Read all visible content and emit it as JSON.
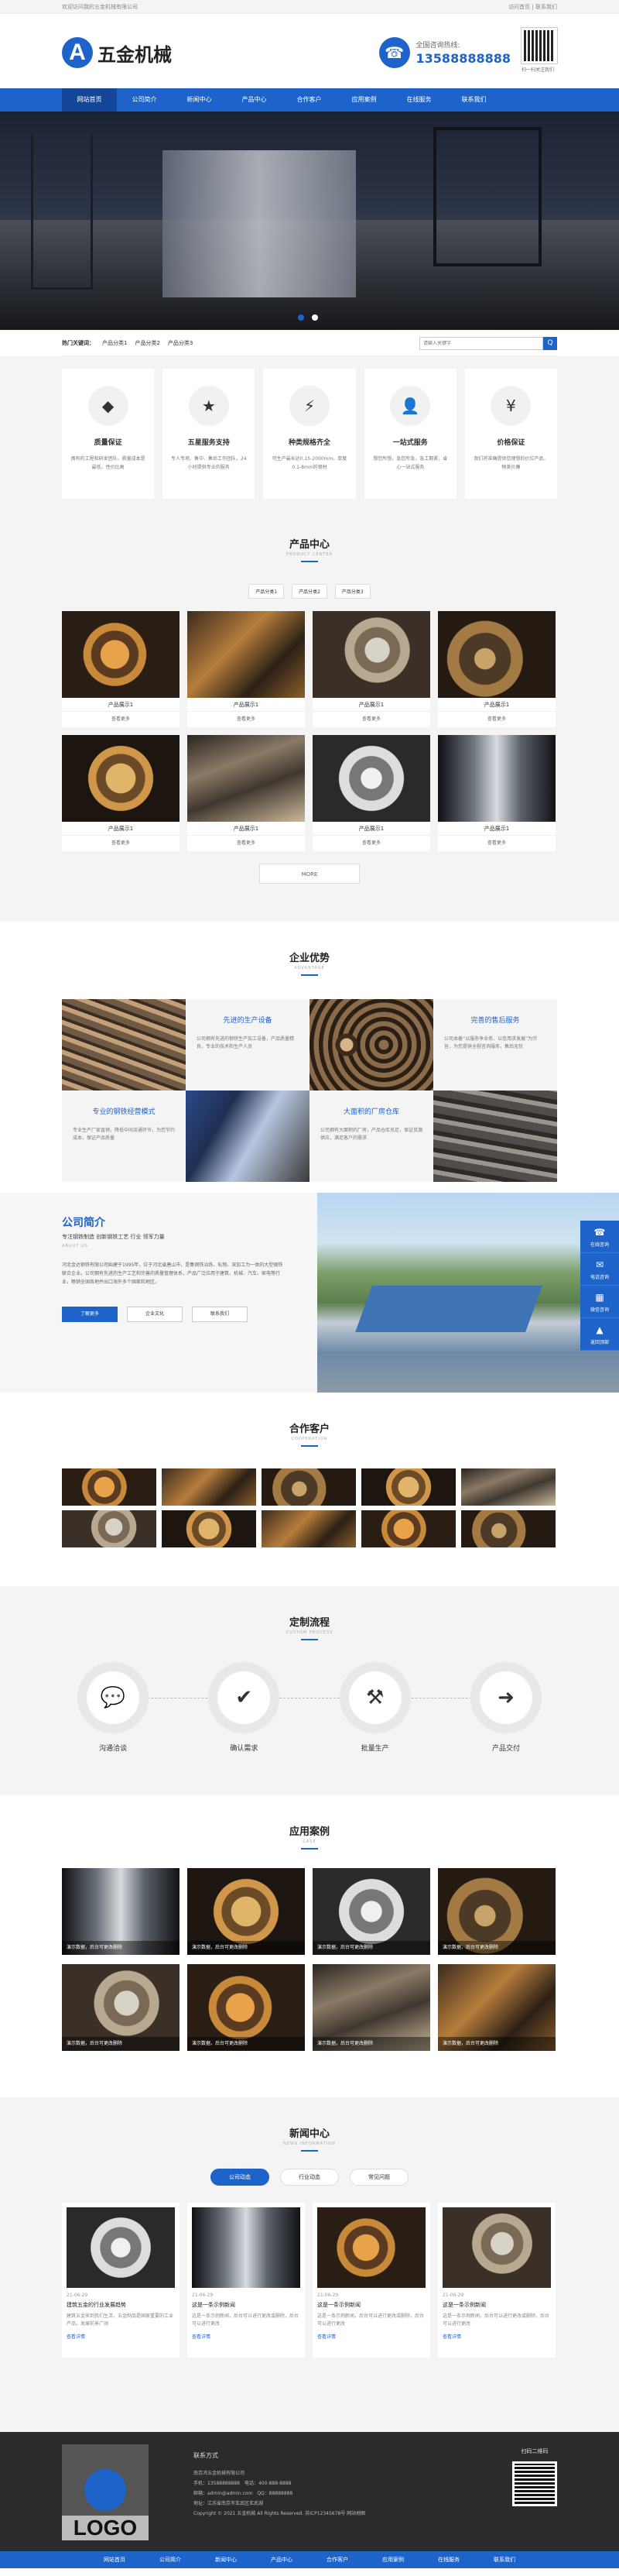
{
  "topbar": {
    "welcome": "欢迎访问我的五金机械有限公司",
    "links": "访问首页 | 联系我们"
  },
  "header": {
    "logo_letter": "A",
    "site_name": "五金机械",
    "hotline_label": "全国咨询热线:",
    "hotline": "13588888888",
    "qr_caption": "扫一扫关注我们"
  },
  "nav": [
    "网站首页",
    "公司简介",
    "新闻中心",
    "产品中心",
    "合作客户",
    "应用案例",
    "在线服务",
    "联系我们"
  ],
  "search": {
    "hot_label": "热门关键词：",
    "keywords": [
      "产品分类1",
      "产品分类2",
      "产品分类3"
    ],
    "placeholder": "请输入关键字",
    "button": "Q"
  },
  "features": [
    {
      "icon": "◆",
      "title": "质量保证",
      "desc": "拥有的工程和研发团队，质量成本是最低，性价比高"
    },
    {
      "icon": "★",
      "title": "五星服务支持",
      "desc": "专人专项、售中、售后工作团队，24小时提供专业的服务"
    },
    {
      "icon": "⚡",
      "title": "种类规格齐全",
      "desc": "可生产最长达0.15-2000mm，厚度0.1-8mm的钢材"
    },
    {
      "icon": "👤",
      "title": "一站式服务",
      "desc": "想您所想，急您所急，急工期紧，省心一站式服务"
    },
    {
      "icon": "¥",
      "title": "价格保证",
      "desc": "我们将准确提供您理想的价位产品，物美价廉"
    }
  ],
  "products": {
    "title": "产品中心",
    "en": "PRODUCT CENTER",
    "tabs": [
      "产品分类1",
      "产品分类2",
      "产品分类3"
    ],
    "items": [
      {
        "name": "产品展示1",
        "more": "查看更多"
      },
      {
        "name": "产品展示1",
        "more": "查看更多"
      },
      {
        "name": "产品展示1",
        "more": "查看更多"
      },
      {
        "name": "产品展示1",
        "more": "查看更多"
      },
      {
        "name": "产品展示1",
        "more": "查看更多"
      },
      {
        "name": "产品展示1",
        "more": "查看更多"
      },
      {
        "name": "产品展示1",
        "more": "查看更多"
      },
      {
        "name": "产品展示1",
        "more": "查看更多"
      }
    ],
    "more": "MORE"
  },
  "advantages": {
    "title": "企业优势",
    "en": "ADVANTAGE",
    "cells": [
      {
        "title": "先进的生产设备",
        "desc": "公司拥有先进的钢铁生产加工设备，产品质量精良，专业的技术和生产人员"
      },
      {
        "title": "完善的售后服务",
        "desc": "公司本着“以服务争业务，以信用求发展”为宗旨，为您提供全程咨询服务，售后无忧"
      },
      {
        "title": "专业的钢铁经营模式",
        "desc": "专业生产厂家直销，降低中间流通环节，为您节约成本，保证产品质量"
      },
      {
        "title": "大面积的厂房仓库",
        "desc": "公司拥有大面积的厂房，产品仓库充足，保证货源供应，满足客户的需求"
      }
    ]
  },
  "about": {
    "title": "公司简介",
    "subtitle": "专注钢铁制造 创新钢铁工艺 行业 领军力量",
    "en": "ABOUT US",
    "desc": "河北金达钢铁有限公司始建于1995年，位于河北省唐山市，是集钢铁冶炼、轧制、深加工为一体的大型钢铁联合企业。公司拥有先进的生产工艺和完善的质量管理体系，产品广泛应用于建筑、机械、汽车、家电等行业，畅销全国各地并出口海外多个国家和地区。",
    "buttons": [
      "了解更多",
      "企业文化",
      "联系我们"
    ]
  },
  "customers": {
    "title": "合作客户",
    "en": "COOPERATION"
  },
  "process": {
    "title": "定制流程",
    "en": "CUSTOM PROCESS",
    "steps": [
      {
        "icon": "💬",
        "label": "沟通洽谈"
      },
      {
        "icon": "✔",
        "label": "确认需求"
      },
      {
        "icon": "⚒",
        "label": "批量生产"
      },
      {
        "icon": "➜",
        "label": "产品交付"
      }
    ]
  },
  "cases": {
    "title": "应用案例",
    "en": "CASE",
    "items": [
      "演示数据，后台可更改删除",
      "演示数据，后台可更改删除",
      "演示数据，后台可更改删除",
      "演示数据，后台可更改删除",
      "演示数据，后台可更改删除",
      "演示数据，后台可更改删除",
      "演示数据，后台可更改删除",
      "演示数据，后台可更改删除"
    ]
  },
  "news": {
    "title": "新闻中心",
    "en": "NEWS INFORMATION",
    "tabs": [
      "公司动态",
      "行业动态",
      "常见问题"
    ],
    "items": [
      {
        "date": "21-06-29",
        "title": "建筑五金的行业发展趋势",
        "desc": "建筑五金来到我们生活，五金制品是国家重要的工业产品，发展前景广阔",
        "more": "查看详情"
      },
      {
        "date": "21-06-29",
        "title": "这是一条示例新闻",
        "desc": "这是一条示例新闻，后台可以进行更改或删除，后台可以进行更改",
        "more": "查看详情"
      },
      {
        "date": "21-06-29",
        "title": "这是一条示例新闻",
        "desc": "这是一条示例新闻，后台可以进行更改或删除，后台可以进行更改",
        "more": "查看详情"
      },
      {
        "date": "21-06-29",
        "title": "这是一条示例新闻",
        "desc": "这是一条示例新闻，后台可以进行更改或删除，后台可以进行更改",
        "more": "查看详情"
      }
    ]
  },
  "footer": {
    "logo_word": "LOGO",
    "contact_title": "联系方式",
    "lines": [
      "南京鸿五金机械有限公司",
      "手机：13588888888　电话：400-888-8888",
      "邮箱：admin@admin.com　QQ：88888888",
      "地址：江苏省南京市玄武区玄武湖",
      "Copyright © 2021 五金机械 All Rights Reserved. 苏ICP12345678号 网站地图"
    ],
    "qr_title": "扫码二维码"
  },
  "footer_nav": [
    "网站首页",
    "公司简介",
    "新闻中心",
    "产品中心",
    "合作客户",
    "应用案例",
    "在线服务",
    "联系我们"
  ],
  "side": [
    {
      "icon": "☎",
      "label": "在线咨询"
    },
    {
      "icon": "✉",
      "label": "电话咨询"
    },
    {
      "icon": "▦",
      "label": "微信咨询"
    },
    {
      "icon": "▲",
      "label": "返回顶部"
    }
  ]
}
